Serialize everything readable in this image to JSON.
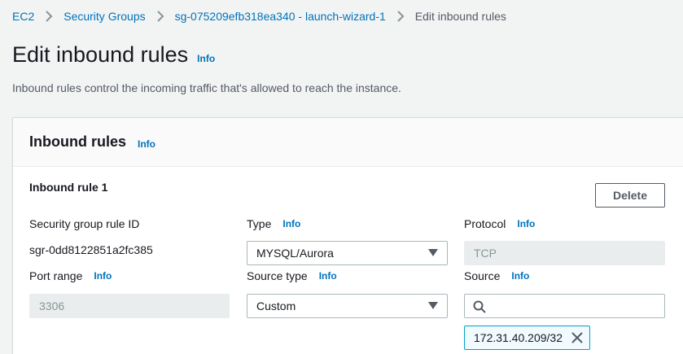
{
  "breadcrumb": {
    "items": [
      {
        "label": "EC2"
      },
      {
        "label": "Security Groups"
      },
      {
        "label": "sg-075209efb318ea340 - launch-wizard-1"
      }
    ],
    "current": "Edit inbound rules"
  },
  "page": {
    "title": "Edit inbound rules",
    "title_info": "Info",
    "description": "Inbound rules control the incoming traffic that's allowed to reach the instance."
  },
  "panel": {
    "title": "Inbound rules",
    "title_info": "Info",
    "rule": {
      "title": "Inbound rule 1",
      "delete_label": "Delete",
      "rule_id": {
        "label": "Security group rule ID",
        "value": "sgr-0dd8122851a2fc385"
      },
      "type": {
        "label": "Type",
        "info": "Info",
        "value": "MYSQL/Aurora"
      },
      "protocol": {
        "label": "Protocol",
        "info": "Info",
        "value": "TCP"
      },
      "port_range": {
        "label": "Port range",
        "info": "Info",
        "value": "3306"
      },
      "source_type": {
        "label": "Source type",
        "info": "Info",
        "value": "Custom"
      },
      "source": {
        "label": "Source",
        "info": "Info",
        "search_value": "",
        "token": "172.31.40.209/32"
      }
    }
  },
  "colors": {
    "link": "#0073bb",
    "background": "#f2f3f3",
    "token_border": "#00a1c9"
  },
  "icons": {
    "breadcrumb_separator": "chevron-right-icon",
    "select_arrow": "caret-down-icon",
    "search": "search-icon",
    "token_remove": "close-icon"
  }
}
